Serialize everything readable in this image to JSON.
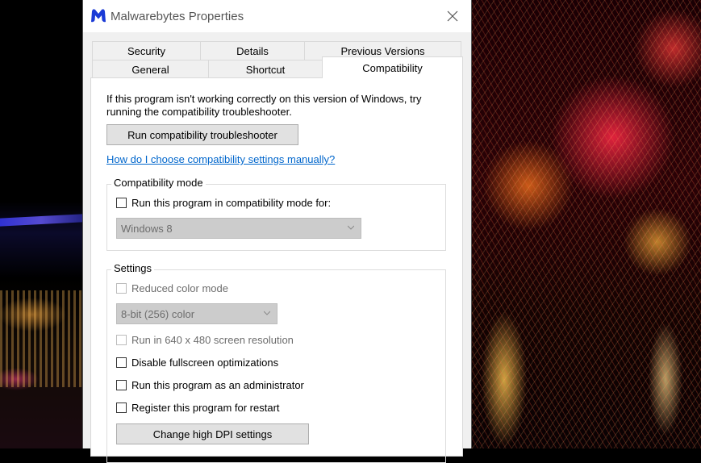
{
  "window": {
    "title": "Malwarebytes Properties"
  },
  "tabs": [
    {
      "label": "Security"
    },
    {
      "label": "Details"
    },
    {
      "label": "Previous Versions"
    },
    {
      "label": "General"
    },
    {
      "label": "Shortcut"
    },
    {
      "label": "Compatibility",
      "active": true
    }
  ],
  "compat": {
    "intro": "If this program isn't working correctly on this version of Windows, try running the compatibility troubleshooter.",
    "troubleshooter_button": "Run compatibility troubleshooter",
    "manual_link": "How do I choose compatibility settings manually?",
    "mode_group": {
      "legend": "Compatibility mode",
      "checkbox_label": "Run this program in compatibility mode for:",
      "checked": false,
      "os_select": "Windows 8"
    },
    "settings_group": {
      "legend": "Settings",
      "reduced_color": {
        "label": "Reduced color mode",
        "enabled": false,
        "checked": false
      },
      "color_select": "8-bit (256) color",
      "res_640": {
        "label": "Run in 640 x 480 screen resolution",
        "enabled": false,
        "checked": false
      },
      "fullscreen_opt": {
        "label": "Disable fullscreen optimizations",
        "checked": false
      },
      "run_admin": {
        "label": "Run this program as an administrator",
        "checked": false
      },
      "register_restart": {
        "label": "Register this program for restart",
        "checked": false
      },
      "dpi_button": "Change high DPI settings"
    }
  },
  "colors": {
    "link": "#0066cc",
    "brand": "#1a3ad6"
  },
  "icons": {
    "app": "malwarebytes-logo-icon",
    "close": "close-icon",
    "dropdown": "chevron-down-icon"
  }
}
